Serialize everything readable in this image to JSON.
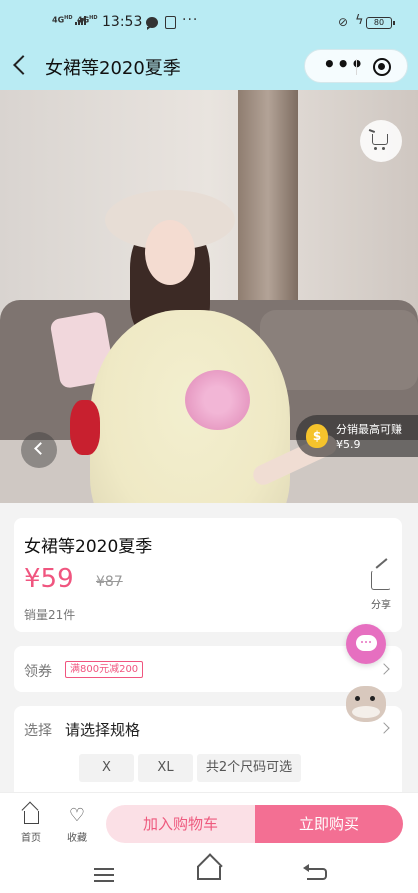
{
  "status_bar": {
    "signal_1": "4G",
    "signal_1_sup": "HD",
    "signal_2": "4G",
    "signal_2_sup": "HD",
    "time": "13:53",
    "dots": "···",
    "battery": "80"
  },
  "nav": {
    "title": "女裙等2020夏季",
    "more": "•••"
  },
  "hero": {
    "distribution_label": "分销最高可赚",
    "distribution_value": "¥5.9",
    "coin_symbol": "$"
  },
  "product": {
    "title": "女裙等2020夏季",
    "price": "¥59",
    "original_price": "¥87",
    "share_label": "分享",
    "sales": "销量21件"
  },
  "coupon": {
    "label": "领券",
    "tag": "满800元减200"
  },
  "spec": {
    "label": "选择",
    "value": "请选择规格",
    "sizes": [
      "X",
      "XL",
      "共2个尺码可选"
    ]
  },
  "bottom_bar": {
    "home_label": "首页",
    "favorite_label": "收藏",
    "add_to_cart": "加入购物车",
    "buy_now": "立即购买"
  },
  "colors": {
    "accent": "#f0557f",
    "header_bg": "#b9ebf3",
    "buy_button": "#f36f93",
    "cart_button": "#fbe0e6"
  },
  "icons": [
    "back-icon",
    "more-icon",
    "target-icon",
    "cart-icon",
    "chevron-left-icon",
    "coin-icon",
    "share-icon",
    "chevron-right-icon",
    "chat-icon",
    "home-icon",
    "heart-icon"
  ]
}
